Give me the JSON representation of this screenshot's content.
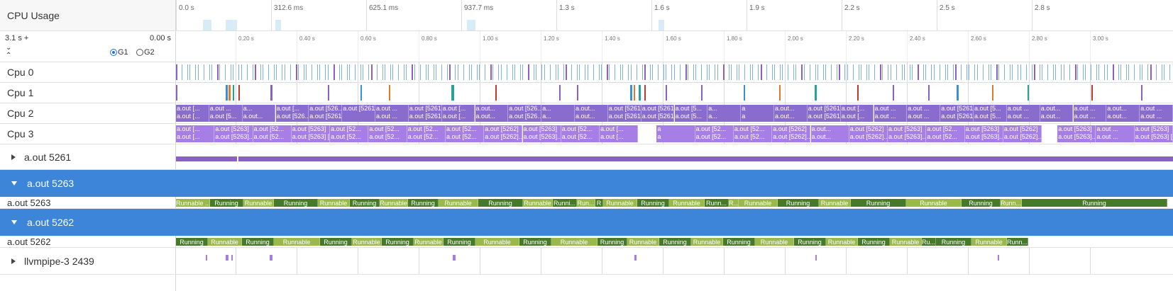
{
  "cpu_usage": {
    "label": "CPU Usage",
    "ticks": [
      "0.0 s",
      "312.6 ms",
      "625.1 ms",
      "937.7 ms",
      "1.3 s",
      "1.6 s",
      "1.9 s",
      "2.2 s",
      "2.5 s",
      "2.8 s"
    ]
  },
  "ruler": {
    "range_label": "3.1 s +",
    "offset_label": "0.00 s",
    "groups": [
      {
        "label": "G1",
        "selected": true
      },
      {
        "label": "G2",
        "selected": false
      }
    ],
    "ticks": [
      "0.20 s",
      "0.40 s",
      "0.60 s",
      "0.80 s",
      "1.00 s",
      "1.20 s",
      "1.40 s",
      "1.60 s",
      "1.80 s",
      "2.00 s",
      "2.20 s",
      "2.40 s",
      "2.60 s",
      "2.80 s",
      "3.00 s"
    ]
  },
  "cpus": [
    {
      "label": "Cpu 0"
    },
    {
      "label": "Cpu 1"
    },
    {
      "label": "Cpu 2",
      "blocks": [
        [
          "a.out [...",
          "a.out [..."
        ],
        [
          "a.out ...",
          "a.out [5..."
        ],
        [
          "a...",
          "a.out..."
        ],
        [
          "a.out [...",
          "a.out [526..."
        ],
        [
          "a.out [526...",
          "a.out [5261] [Prio..."
        ],
        [
          "a.out [5261]",
          ""
        ],
        [
          "a.out ...",
          "a.out ..."
        ],
        [
          "a.out [5261]",
          "a.out [5261] [Prio:120]"
        ],
        [
          "a.out [...",
          "a.out [..."
        ],
        [
          "a.out...",
          "a.out..."
        ],
        [
          "a.out [526...",
          "a.out [526..."
        ],
        [
          "a...",
          "a..."
        ],
        [
          "a.out...",
          "a.out..."
        ],
        [
          "a.out [5261]",
          "a.out [5261] ..."
        ],
        [
          "a.out [5261]",
          "a.out [5261] ..."
        ],
        [
          "a.out [5...",
          "a.out [5..."
        ],
        [
          "a...",
          "a..."
        ],
        [
          "a",
          "a"
        ],
        [
          "a.out...",
          "a.out..."
        ],
        [
          "a.out [5261]",
          "a.out [5261] [Prio..."
        ],
        [
          "a.out [...",
          "a.out [..."
        ],
        [
          "a.out ...",
          "a.out ..."
        ],
        [
          "a.out ...",
          "a.out ..."
        ],
        [
          "a.out [5261]",
          "a.out [5261] [Prio:120]"
        ],
        [
          "a.out [5...",
          "a.out [5..."
        ],
        [
          "a.out ...",
          "a.out ..."
        ],
        [
          "a.out...",
          "a.out..."
        ],
        [
          "a.out ...",
          "a.out ..."
        ],
        [
          "a.out...",
          "a.out..."
        ],
        [
          "a.out ...",
          "a.out ..."
        ]
      ]
    },
    {
      "label": "Cpu 3",
      "blocks": [
        [
          "a.out [...",
          "a.out [..."
        ],
        [
          "a.out [5263]",
          "a.out [5263]..."
        ],
        [
          "a.out [52...",
          "a.out [52..."
        ],
        [
          "a.out [5263]",
          "a.out [5263] [P..."
        ],
        [
          "a.out [52...",
          "a.out [52..."
        ],
        [
          "a.out [52...",
          "a.out [52..."
        ],
        [
          "a.out [52...",
          "a.out [52..."
        ],
        [
          "a.out [52...",
          "a.out [52..."
        ],
        [
          "a.out [5262]",
          "a.out [5262]..."
        ],
        [
          "a.out [5263]",
          "a.out [5263]..."
        ],
        [
          "a.out [52...",
          "a.out [52..."
        ],
        [
          "a.out [...",
          "a.out [..."
        ],
        [
          "a",
          "a"
        ],
        [
          "a.out [52...",
          "a.out [52..."
        ],
        [
          "a.out [52...",
          "a.out [52..."
        ],
        [
          "a.out [5262]",
          "a.out [5262]..."
        ],
        [
          "a.out...",
          "a.out..."
        ],
        [
          "a.out [5262]",
          "a.out [5262]..."
        ],
        [
          "a.out [5263]",
          "a.out [5263]..."
        ],
        [
          "a.out [52...",
          "a.out [52..."
        ],
        [
          "a.out [5263]",
          "a.out [5263]..."
        ],
        [
          "a.out [5262]",
          "a.out [5262]..."
        ],
        [
          "a.out [5263]",
          "a.out [5263]..."
        ],
        [
          "a.out ...",
          "a.out ..."
        ],
        [
          "a.out [5263]",
          "a.out [5263] [Prio:8]"
        ]
      ]
    }
  ],
  "threads": [
    {
      "label": "a.out 5261",
      "expanded": false
    },
    {
      "label": "a.out 5263",
      "expanded": true,
      "row_label": "a.out 5263",
      "states": [
        [
          "Runnable ...",
          "#9bb84c",
          48
        ],
        [
          "Running",
          "#47792a",
          47
        ],
        [
          "Runnable",
          "#9bb84c",
          43
        ],
        [
          "Running",
          "#47792a",
          62
        ],
        [
          "Runnable",
          "#9bb84c",
          45
        ],
        [
          "Running",
          "#47792a",
          42
        ],
        [
          "Runnable",
          "#9bb84c",
          40
        ],
        [
          "Running",
          "#47792a",
          43
        ],
        [
          "Runnable",
          "#9bb84c",
          56
        ],
        [
          "Running",
          "#47792a",
          63
        ],
        [
          "Runnable",
          "#9bb84c",
          42
        ],
        [
          "Runni...",
          "#47792a",
          34
        ],
        [
          "Run...",
          "#9bb84c",
          26
        ],
        [
          "R",
          "#47792a",
          11
        ],
        [
          "Runnable",
          "#9bb84c",
          48
        ],
        [
          "Running",
          "#47792a",
          45
        ],
        [
          "Runnable",
          "#9bb84c",
          50
        ],
        [
          "Runn...",
          "#47792a",
          34
        ],
        [
          "R...",
          "#9bb84c",
          14
        ],
        [
          "Runnable",
          "#9bb84c",
          55
        ],
        [
          "Running",
          "#47792a",
          58
        ],
        [
          "Runnable",
          "#9bb84c",
          45
        ],
        [
          "Running",
          "#47792a",
          78
        ],
        [
          "Runnable",
          "#9bb84c",
          78
        ],
        [
          "Running",
          "#47792a",
          55
        ],
        [
          "Runn...",
          "#9bb84c",
          30
        ],
        [
          "Running",
          "#47792a",
          205
        ]
      ]
    },
    {
      "label": "a.out 5262",
      "expanded": true,
      "row_label": "a.out 5262",
      "states": [
        [
          "Running",
          "#47792a",
          45
        ],
        [
          "Runnable",
          "#9bb84c",
          48
        ],
        [
          "Running",
          "#47792a",
          45
        ],
        [
          "Runnable",
          "#9bb84c",
          65
        ],
        [
          "Running",
          "#47792a",
          45
        ],
        [
          "Runnable",
          "#9bb84c",
          42
        ],
        [
          "Running",
          "#47792a",
          45
        ],
        [
          "Runnable",
          "#9bb84c",
          42
        ],
        [
          "Running",
          "#47792a",
          45
        ],
        [
          "Runnable",
          "#9bb84c",
          62
        ],
        [
          "Running",
          "#47792a",
          45
        ],
        [
          "Runnable",
          "#9bb84c",
          65
        ],
        [
          "Running",
          "#47792a",
          42
        ],
        [
          "Runnable",
          "#9bb84c",
          45
        ],
        [
          "Running",
          "#47792a",
          45
        ],
        [
          "Runnable",
          "#9bb84c",
          45
        ],
        [
          "Running",
          "#47792a",
          45
        ],
        [
          "Runnable",
          "#9bb84c",
          55
        ],
        [
          "Running",
          "#47792a",
          45
        ],
        [
          "Runnable",
          "#9bb84c",
          45
        ],
        [
          "Running",
          "#47792a",
          45
        ],
        [
          "Runnable",
          "#9bb84c",
          45
        ],
        [
          "Ru...",
          "#47792a",
          20
        ],
        [
          "Running",
          "#47792a",
          50
        ],
        [
          "Runnable",
          "#9bb84c",
          50
        ],
        [
          "Runn...",
          "#47792a",
          30
        ]
      ]
    },
    {
      "label": "llvmpipe-3 2439",
      "expanded": false
    }
  ]
}
